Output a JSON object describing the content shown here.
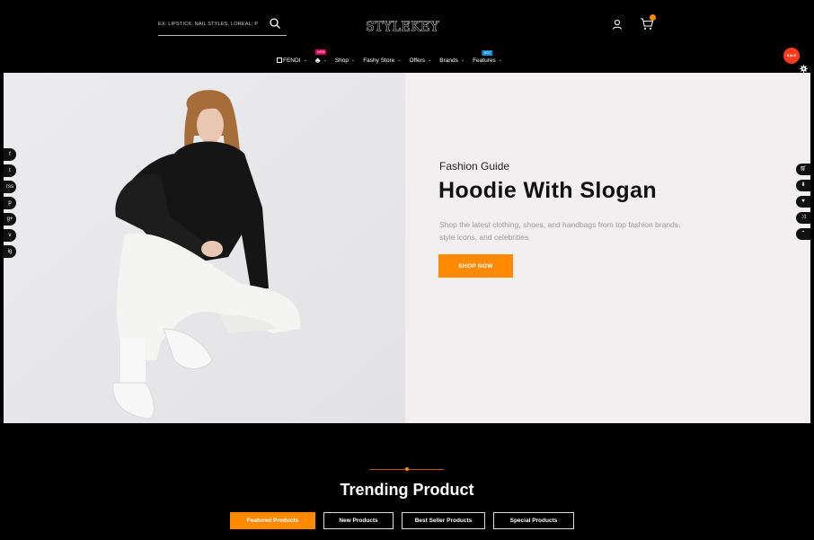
{
  "header": {
    "search_placeholder": "EX: LIPSTICK, NAIL STYLES, LOREAL, P",
    "logo": "STYLEKEY",
    "cart_count": ""
  },
  "nav": {
    "items": [
      {
        "label": "FENDI",
        "icon": "fendi-box-icon",
        "badge": ""
      },
      {
        "label": "",
        "icon": "club-icon",
        "badge": "NEW"
      },
      {
        "label": "Shop",
        "badge": ""
      },
      {
        "label": "Fashy Store",
        "badge": ""
      },
      {
        "label": "Offers",
        "badge": ""
      },
      {
        "label": "Brands",
        "badge": ""
      },
      {
        "label": "Features",
        "badge": "HOT"
      }
    ]
  },
  "floating": {
    "sale_label": "SALE"
  },
  "hero": {
    "eyebrow": "Fashion Guide",
    "title": "Hoodie With Slogan",
    "description": "Shop the latest clothing, shoes, and handbags from top fashion brands, style icons, and celebrities",
    "cta": "SHOP NOW"
  },
  "social": [
    "f",
    "t",
    "rss",
    "p",
    "g+",
    "v",
    "ig"
  ],
  "trending": {
    "title": "Trending Product",
    "tabs": [
      {
        "label": "Featured Products",
        "active": true
      },
      {
        "label": "New Products",
        "active": false
      },
      {
        "label": "Best Seller Products",
        "active": false
      },
      {
        "label": "Special Products",
        "active": false
      }
    ]
  },
  "colors": {
    "accent": "#ff8a00",
    "badge_new": "#e3005e",
    "badge_hot": "#1a8ad2",
    "sale": "#ff3b1d"
  }
}
